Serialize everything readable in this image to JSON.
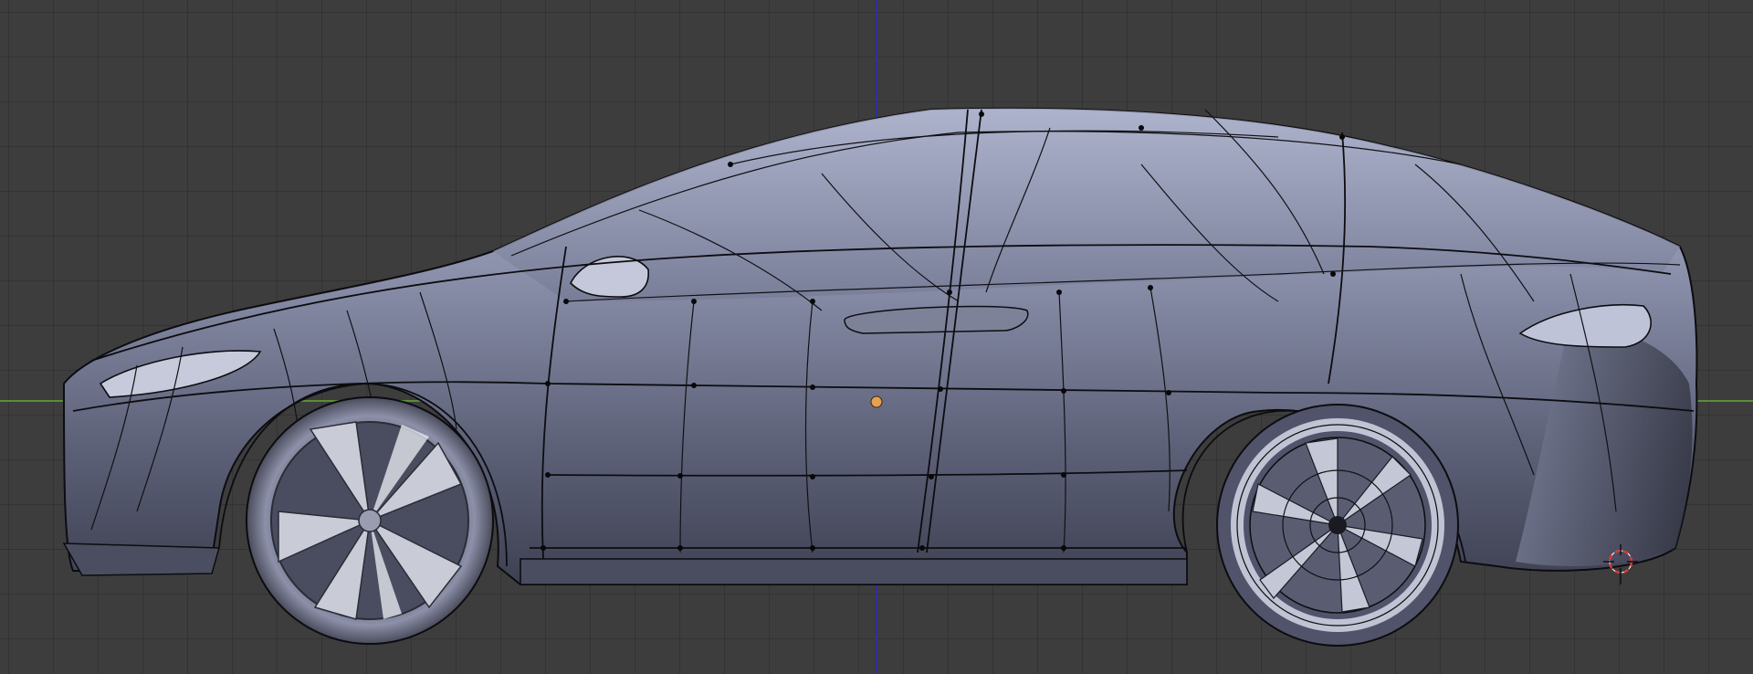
{
  "app": "3D viewport",
  "view": {
    "mode": "edit-mode-wireframe-overlay",
    "object": "car-mesh"
  },
  "colors": {
    "background": "#3d3d3d",
    "grid_line": "#363636",
    "x_axis": "#5a8d3a",
    "z_axis": "#2f2f9a",
    "mesh_body": "#6b7088",
    "mesh_highlight": "#a9afcb",
    "wire": "#0c0c10",
    "origin_dot": "#e8a050",
    "cursor_ring_red": "#d83a3a"
  },
  "icons": [
    "3d-cursor-icon",
    "object-origin-icon"
  ]
}
